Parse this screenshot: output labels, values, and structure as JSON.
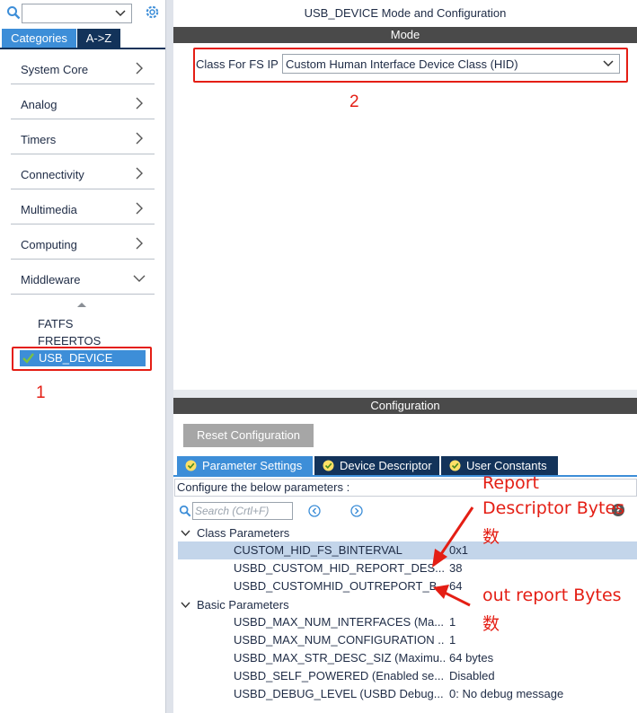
{
  "sidebar": {
    "search_value": "",
    "tabs": [
      {
        "label": "Categories"
      },
      {
        "label": "A->Z"
      }
    ],
    "categories": [
      {
        "label": "System Core",
        "expanded": false
      },
      {
        "label": "Analog",
        "expanded": false
      },
      {
        "label": "Timers",
        "expanded": false
      },
      {
        "label": "Connectivity",
        "expanded": false
      },
      {
        "label": "Multimedia",
        "expanded": false
      },
      {
        "label": "Computing",
        "expanded": false
      },
      {
        "label": "Middleware",
        "expanded": true
      }
    ],
    "middleware_items": [
      {
        "label": "FATFS"
      },
      {
        "label": "FREERTOS"
      },
      {
        "label": "USB_DEVICE",
        "selected": true,
        "enabled": true
      }
    ]
  },
  "header": {
    "title": "USB_DEVICE Mode and Configuration"
  },
  "mode": {
    "section_label": "Mode",
    "class_label": "Class For FS IP",
    "class_value": "Custom Human Interface Device Class (HID)"
  },
  "configuration": {
    "section_label": "Configuration",
    "reset_label": "Reset Configuration",
    "tabs": [
      {
        "label": "Parameter Settings",
        "active": true
      },
      {
        "label": "Device Descriptor",
        "active": false
      },
      {
        "label": "User Constants",
        "active": false
      }
    ],
    "configure_text": "Configure the below parameters :",
    "search_placeholder": "Search (Crtl+F)",
    "groups": [
      {
        "label": "Class Parameters",
        "rows": [
          {
            "name": "CUSTOM_HID_FS_BINTERVAL",
            "value": "0x1",
            "selected": true
          },
          {
            "name": "USBD_CUSTOM_HID_REPORT_DES...",
            "value": "38"
          },
          {
            "name": "USBD_CUSTOMHID_OUTREPORT_B...",
            "value": "64"
          }
        ]
      },
      {
        "label": "Basic Parameters",
        "rows": [
          {
            "name": "USBD_MAX_NUM_INTERFACES (Ma...",
            "value": "1"
          },
          {
            "name": "USBD_MAX_NUM_CONFIGURATION ...",
            "value": "1"
          },
          {
            "name": "USBD_MAX_STR_DESC_SIZ (Maximu...",
            "value": "64 bytes"
          },
          {
            "name": "USBD_SELF_POWERED (Enabled se...",
            "value": "Disabled"
          },
          {
            "name": "USBD_DEBUG_LEVEL (USBD Debug...",
            "value": "0: No debug message"
          }
        ]
      }
    ]
  },
  "annotations": {
    "marker_1": "1",
    "marker_2": "2",
    "report_line1": "Report",
    "report_line2": "Descriptor Bytes",
    "report_line3": "数",
    "out_line1": "out report Bytes",
    "out_line2": "数"
  },
  "icons": {
    "search": "search-icon",
    "settings": "gear-icon",
    "dropdown": "chevron-down-icon",
    "expand": "chevron-right-icon",
    "check": "check-icon",
    "tab_status": "check-circle-icon",
    "help": "help-icon"
  },
  "colors": {
    "accent": "#3d8ed8",
    "navy": "#13335a",
    "header_bar": "#4a4a4a",
    "selection": "#c3d5ea",
    "annotation": "#e41e14",
    "check_green": "#7cc142"
  }
}
